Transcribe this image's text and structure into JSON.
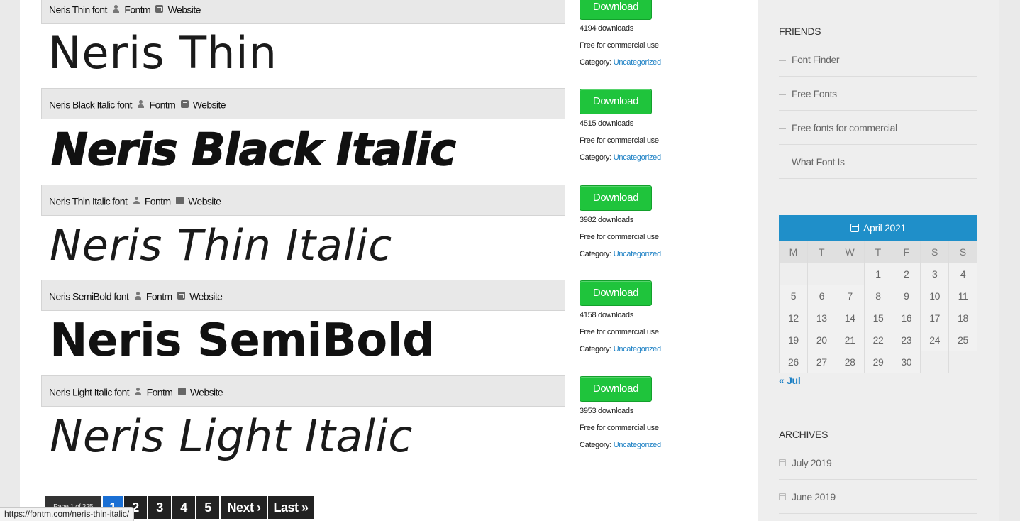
{
  "fonts": [
    {
      "name": "Neris Thin font",
      "author": "Fontm",
      "website": "Website",
      "preview": "Neris Thin",
      "download": "Download",
      "downloads": "4194 downloads",
      "license": "Free for commercial use",
      "category_label": "Category:",
      "category": "Uncategorized"
    },
    {
      "name": "Neris Black Italic font",
      "author": "Fontm",
      "website": "Website",
      "preview": "Neris Black Italic",
      "download": "Download",
      "downloads": "4515 downloads",
      "license": "Free for commercial use",
      "category_label": "Category:",
      "category": "Uncategorized"
    },
    {
      "name": "Neris Thin Italic font",
      "author": "Fontm",
      "website": "Website",
      "preview": "Neris Thin Italic",
      "download": "Download",
      "downloads": "3982 downloads",
      "license": "Free for commercial use",
      "category_label": "Category:",
      "category": "Uncategorized"
    },
    {
      "name": "Neris SemiBold font",
      "author": "Fontm",
      "website": "Website",
      "preview": "Neris SemiBold",
      "download": "Download",
      "downloads": "4158 downloads",
      "license": "Free for commercial use",
      "category_label": "Category:",
      "category": "Uncategorized"
    },
    {
      "name": "Neris Light Italic font",
      "author": "Fontm",
      "website": "Website",
      "preview": "Neris Light Italic",
      "download": "Download",
      "downloads": "3953 downloads",
      "license": "Free for commercial use",
      "category_label": "Category:",
      "category": "Uncategorized"
    }
  ],
  "pagination": {
    "info": "Page 1 of 325",
    "pages": [
      "1",
      "2",
      "3",
      "4",
      "5"
    ],
    "active": "1",
    "next": "Next ›",
    "last": "Last »"
  },
  "status_url": "https://fontm.com/neris-thin-italic/",
  "sidebar": {
    "friends_title": "FRIENDS",
    "friends": [
      "Font Finder",
      "Free Fonts",
      "Free fonts for commercial",
      "What Font Is"
    ],
    "calendar": {
      "month": "April 2021",
      "weekdays": [
        "M",
        "T",
        "W",
        "T",
        "F",
        "S",
        "S"
      ],
      "weeks": [
        [
          "",
          "",
          "",
          "1",
          "2",
          "3",
          "4"
        ],
        [
          "5",
          "6",
          "7",
          "8",
          "9",
          "10",
          "11"
        ],
        [
          "12",
          "13",
          "14",
          "15",
          "16",
          "17",
          "18"
        ],
        [
          "19",
          "20",
          "21",
          "22",
          "23",
          "24",
          "25"
        ],
        [
          "26",
          "27",
          "28",
          "29",
          "30",
          "",
          ""
        ]
      ],
      "prev": "« Jul"
    },
    "archives_title": "ARCHIVES",
    "archives": [
      "July 2019",
      "June 2019"
    ]
  },
  "colors": {
    "download_button": "#1fc43c",
    "link": "#1a7fc4",
    "calendar_header": "#1f8fc9",
    "active_page": "#1a6fd4"
  }
}
